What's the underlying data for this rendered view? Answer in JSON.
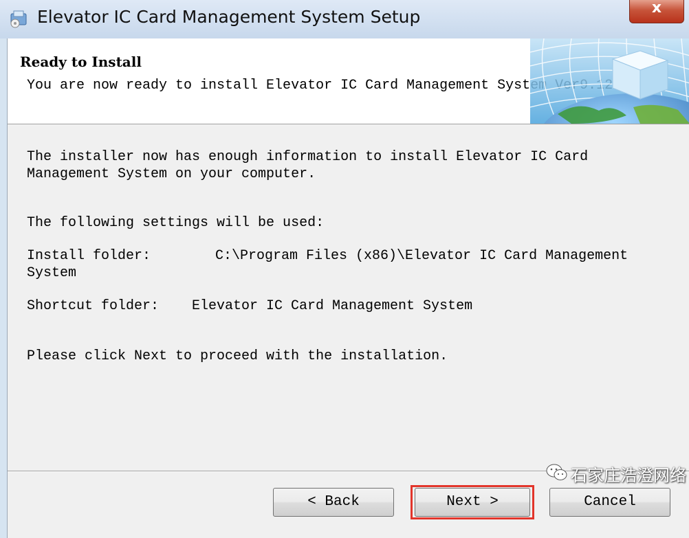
{
  "window": {
    "title": "Elevator IC Card Management System Setup",
    "close_label": "x"
  },
  "header": {
    "title": "Ready to Install",
    "subtitle": "You are now ready to install Elevator IC Card Management System Ver9.12"
  },
  "body": {
    "line1": "The installer now has enough information to install Elevator IC Card",
    "line2": "Management System on your computer.",
    "settings_intro": "The following settings will be used:",
    "install_folder_label": "Install folder:",
    "install_folder_value_line1": "C:\\Program Files (x86)\\Elevator IC Card Management",
    "install_folder_value_line2": "System",
    "shortcut_folder_label": "Shortcut folder:",
    "shortcut_folder_value": "Elevator IC Card Management System",
    "proceed": "Please click Next to proceed with the installation."
  },
  "buttons": {
    "back": "< Back",
    "next": "Next >",
    "cancel": "Cancel"
  },
  "watermark": {
    "text": "石家庄浩澄网络"
  },
  "colors": {
    "highlight_outline": "#e2352b",
    "close_button": "#c7543a"
  }
}
